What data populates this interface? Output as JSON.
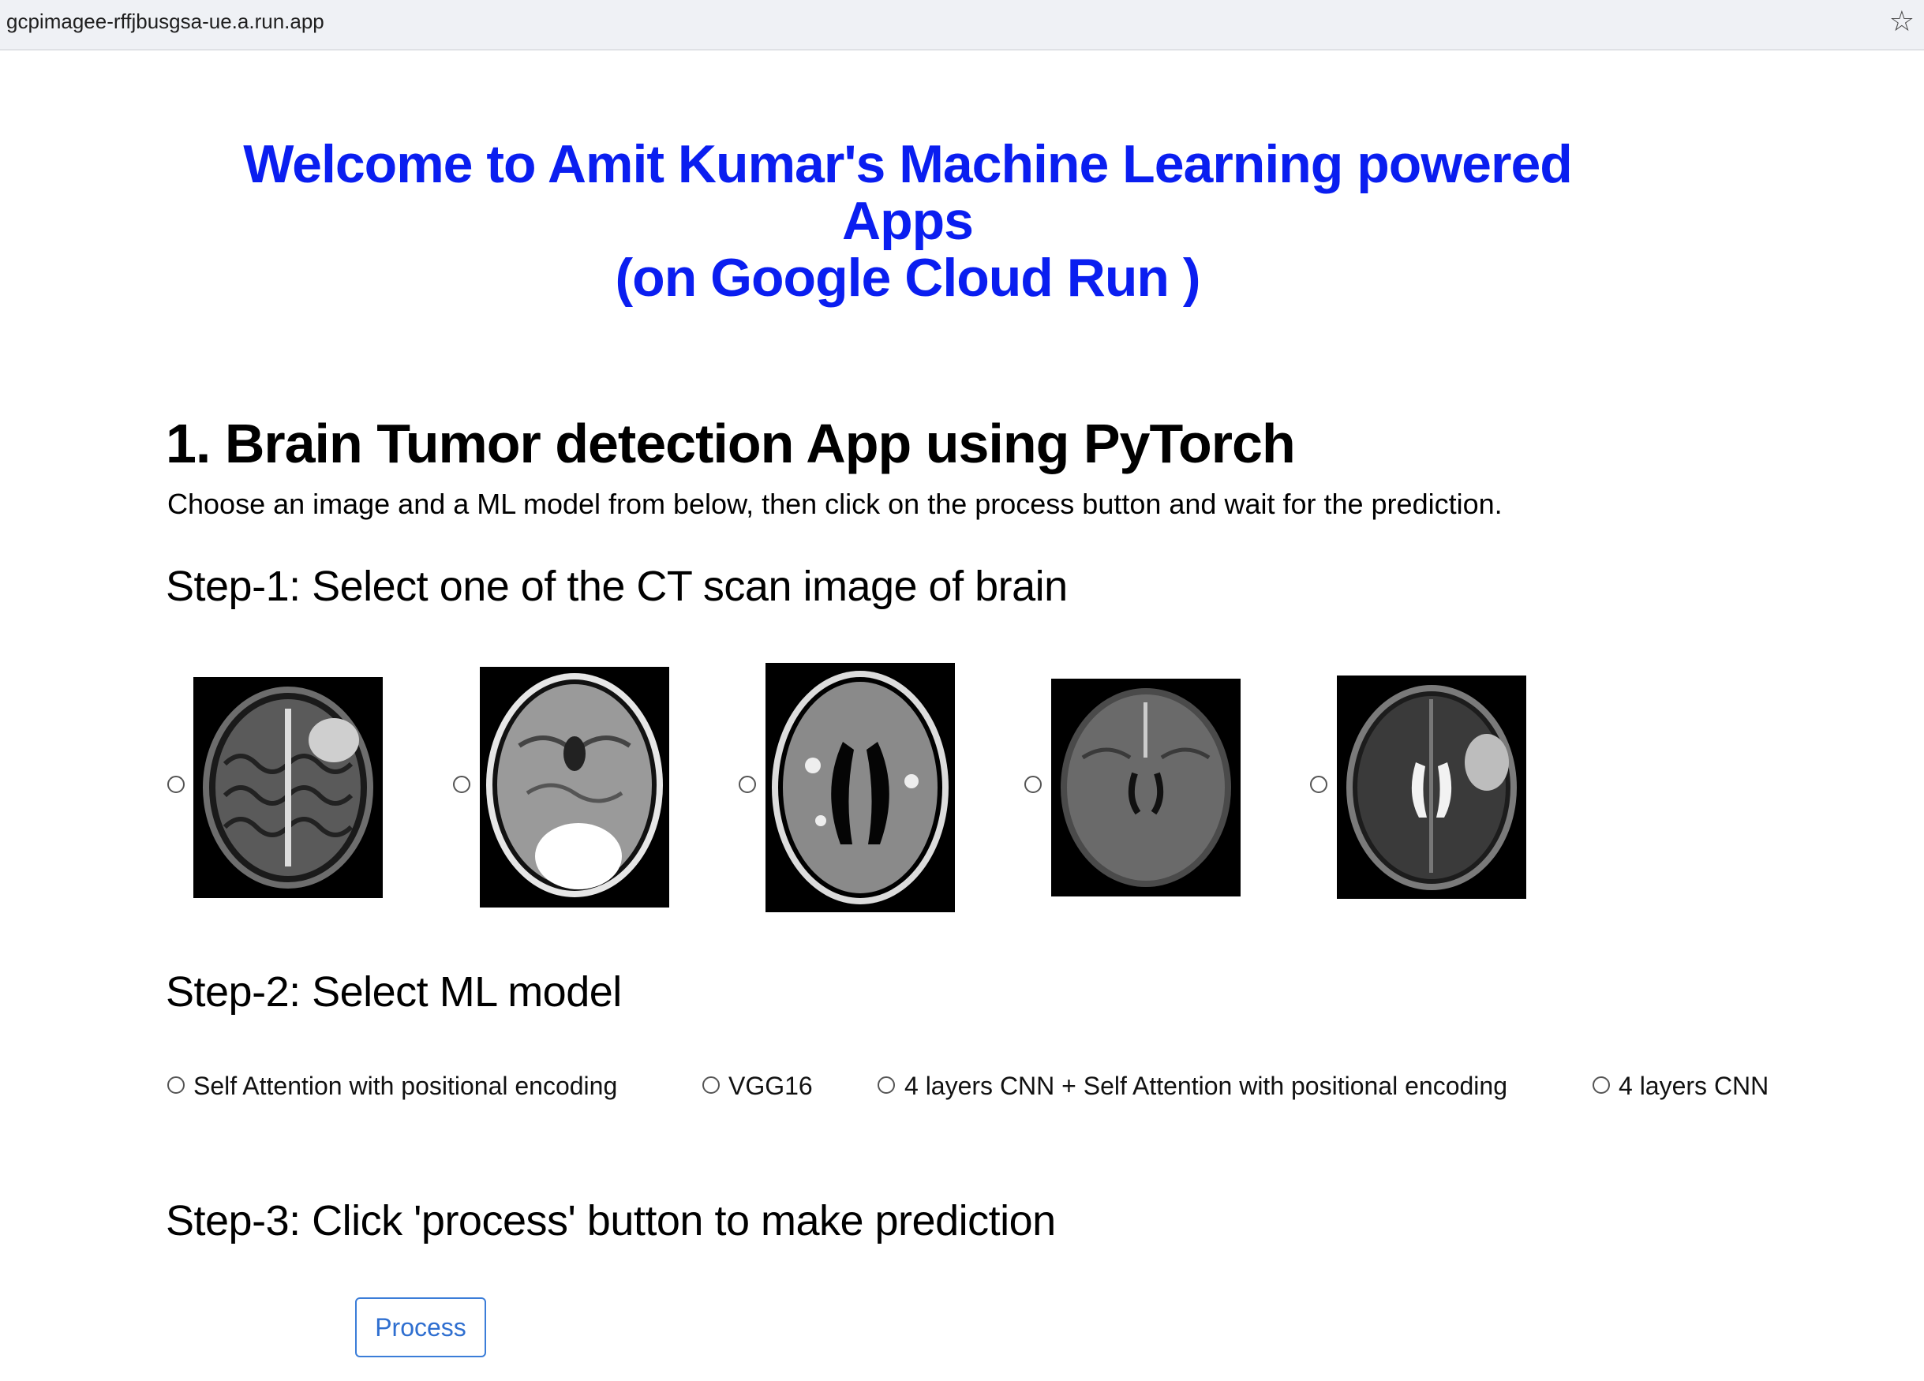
{
  "browser": {
    "url": "gcpimagee-rffjbusgsa-ue.a.run.app",
    "bookmark_icon": "star-icon"
  },
  "header": {
    "welcome_line1": "Welcome to Amit Kumar's Machine Learning powered Apps",
    "welcome_line2": "(on Google Cloud Run )"
  },
  "app": {
    "title": "1. Brain Tumor detection App using PyTorch",
    "instructions": "Choose an image and a ML model from below, then click on the process button and wait for the prediction."
  },
  "steps": {
    "step1": "Step-1: Select one of the CT scan image of brain",
    "step2": "Step-2: Select ML model",
    "step3": "Step-3: Click 'process' button to make prediction"
  },
  "models": [
    "Self Attention with positional encoding",
    "VGG16",
    "4 layers CNN + Self Attention with positional encoding",
    "4 layers CNN"
  ],
  "process_button": "Process",
  "colors": {
    "title_blue": "#0a1ef0",
    "button_blue": "#2f6fd0"
  }
}
